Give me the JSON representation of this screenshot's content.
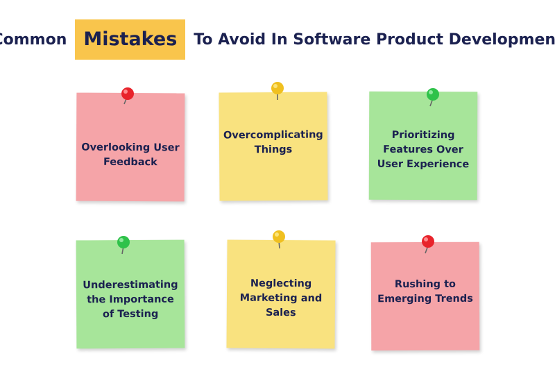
{
  "title": {
    "prefix": "Common",
    "highlight": "Mistakes",
    "suffix": "To Avoid In Software Product Development"
  },
  "colors": {
    "navy": "#1b2150",
    "highlight": "#f9c54c",
    "pink": "#f5a4a8",
    "yellow": "#f9e27f",
    "green": "#a7e59a",
    "pin_red": "#e8232b",
    "pin_yellow": "#f0c020",
    "pin_green": "#2fc24a"
  },
  "notes": [
    {
      "text": "Overlooking User Feedback",
      "color": "pink",
      "pin": "red"
    },
    {
      "text": "Overcomplicating Things",
      "color": "yellow",
      "pin": "yellow"
    },
    {
      "text": "Prioritizing Features Over User Experience",
      "color": "green",
      "pin": "green"
    },
    {
      "text": "Underestimating the Importance of Testing",
      "color": "green",
      "pin": "green"
    },
    {
      "text": "Neglecting Marketing and Sales",
      "color": "yellow",
      "pin": "yellow"
    },
    {
      "text": "Rushing to Emerging Trends",
      "color": "pink",
      "pin": "red"
    }
  ]
}
